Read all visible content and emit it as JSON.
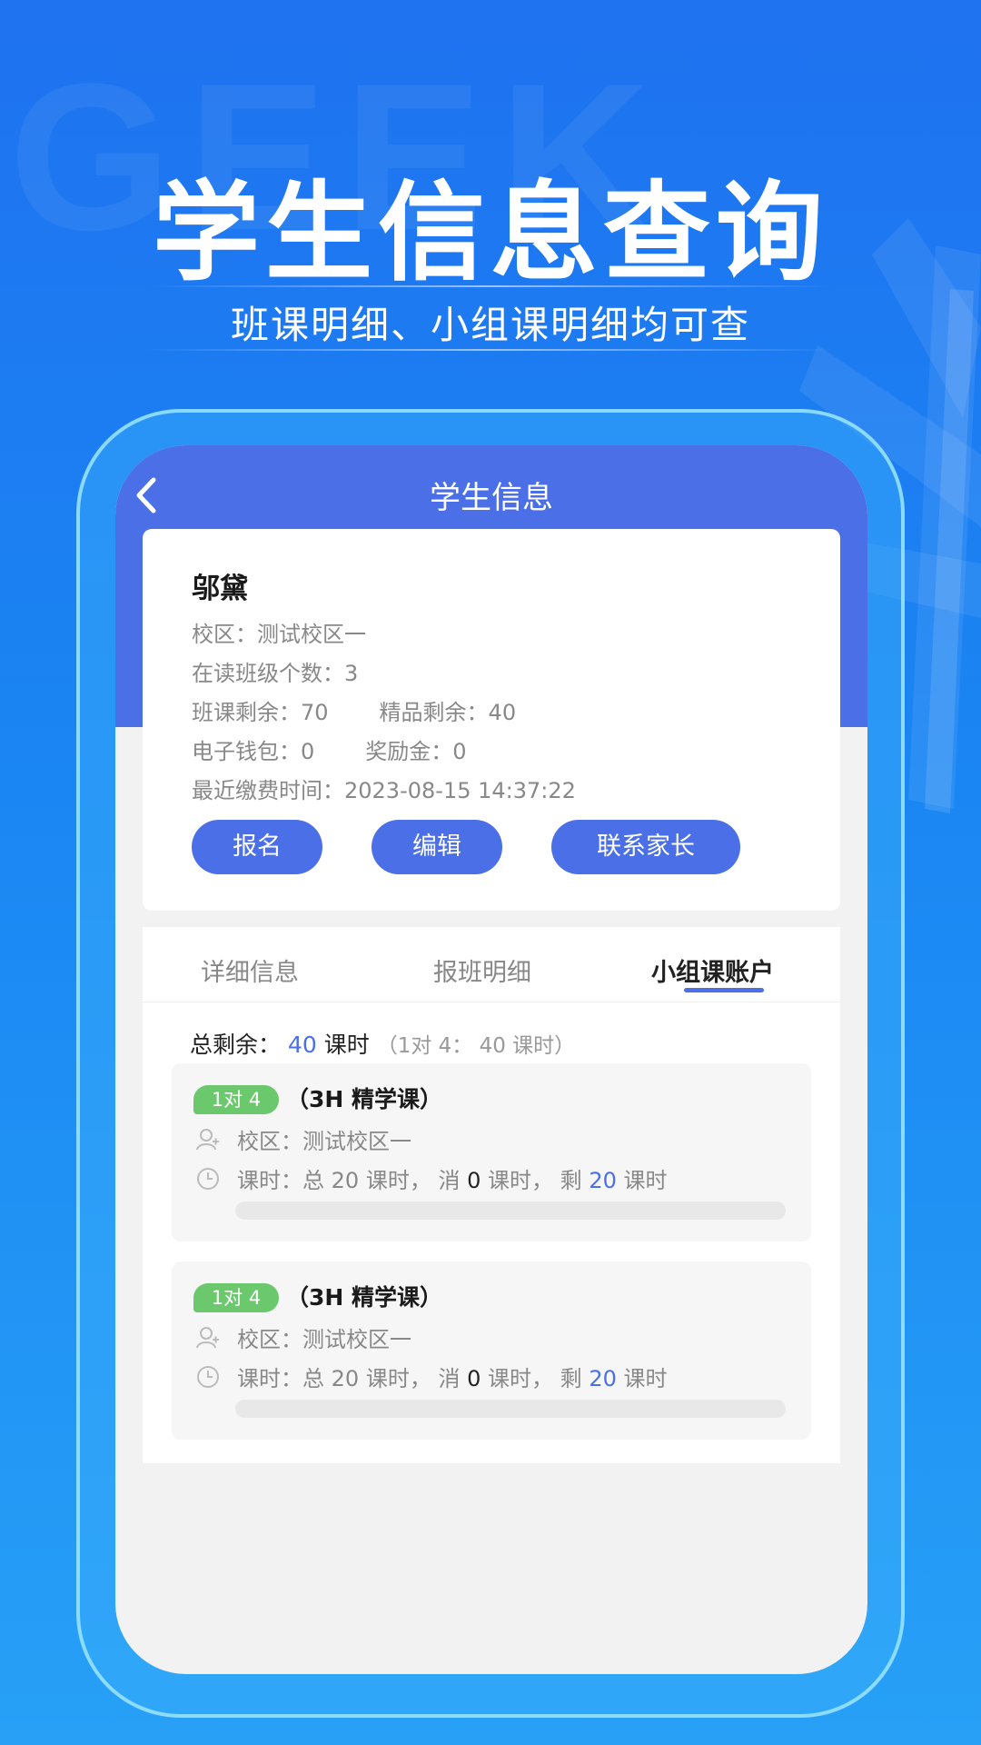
{
  "promo": {
    "watermark": "GEEK",
    "headline": "学生信息查询",
    "subline": "班课明细、小组课明细均可查"
  },
  "header": {
    "title": "学生信息"
  },
  "student": {
    "name": "邬黛",
    "campus_label": "校区：",
    "campus": "测试校区一",
    "classes_label": "在读班级个数：",
    "classes": "3",
    "class_remain_label": "班课剩余：",
    "class_remain": "70",
    "premium_remain_label": "精品剩余：",
    "premium_remain": "40",
    "wallet_label": "电子钱包：",
    "wallet": "0",
    "bonus_label": "奖励金：",
    "bonus": "0",
    "last_pay_label": "最近缴费时间：",
    "last_pay": "2023-08-15 14:37:22"
  },
  "actions": {
    "enroll": "报名",
    "edit": "编辑",
    "contact": "联系家长"
  },
  "tabs": [
    {
      "label": "详细信息",
      "active": false
    },
    {
      "label": "报班明细",
      "active": false
    },
    {
      "label": "小组课账户",
      "active": true
    }
  ],
  "summary": {
    "label": "总剩余：",
    "value": "40",
    "unit": "课时",
    "detail": "（1对 4： 40 课时）"
  },
  "courses": [
    {
      "badge": "1对 4",
      "title": "（3H 精学课）",
      "campus_label": "校区：",
      "campus": "测试校区一",
      "hours_label": "课时：总",
      "total": "20",
      "total_unit": "课时，",
      "used_label": "消",
      "used": "0",
      "used_unit": "课时，",
      "left_label": "剩",
      "left": "20",
      "left_unit": "课时",
      "progress": 0
    },
    {
      "badge": "1对 4",
      "title": "（3H 精学课）",
      "campus_label": "校区：",
      "campus": "测试校区一",
      "hours_label": "课时：总",
      "total": "20",
      "total_unit": "课时，",
      "used_label": "消",
      "used": "0",
      "used_unit": "课时，",
      "left_label": "剩",
      "left": "20",
      "left_unit": "课时",
      "progress": 0
    }
  ],
  "icons": {
    "back": "chevron-left-icon",
    "person": "user-icon",
    "clock": "clock-icon"
  },
  "colors": {
    "primary": "#4a6fe6",
    "badge": "#6cc86c",
    "background": "#1f72f0"
  }
}
